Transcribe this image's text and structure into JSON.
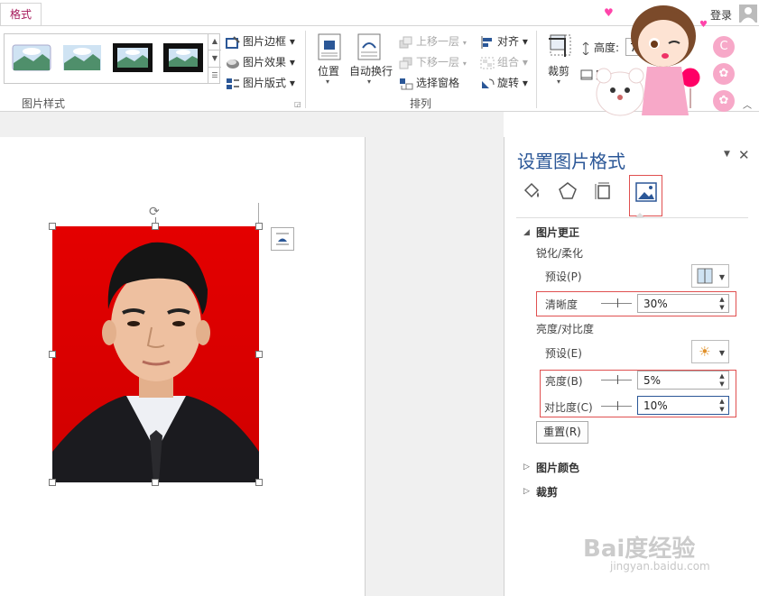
{
  "tabs": {
    "active": "格式"
  },
  "account": {
    "login": "登录"
  },
  "ribbon": {
    "picture_styles": {
      "label": "图片样式"
    },
    "style_buttons": {
      "border": "图片边框",
      "effects": "图片效果",
      "layout": "图片版式"
    },
    "arrange": {
      "label": "排列",
      "position": "位置",
      "wrap_text": "自动换行",
      "bring_forward": "上移一层",
      "send_backward": "下移一层",
      "selection_pane": "选择窗格",
      "align": "对齐",
      "group": "组合",
      "rotate": "旋转"
    },
    "size": {
      "crop": "裁剪",
      "height_label": "高度:",
      "height_value": "7",
      "width_label": "宽"
    }
  },
  "pane": {
    "title": "设置图片格式",
    "section_correction": "图片更正",
    "sharpen_soften": "锐化/柔化",
    "preset": "预设(P)",
    "clarity_label": "清晰度",
    "clarity_value": "30%",
    "brightness_contrast": "亮度/对比度",
    "preset2": "预设(E)",
    "brightness_label": "亮度(B)",
    "brightness_value": "5%",
    "contrast_label": "对比度(C)",
    "contrast_value": "10%",
    "reset": "重置(R)",
    "section_color": "图片颜色",
    "section_crop": "裁剪"
  },
  "watermark": {
    "brand": "Bai度经验",
    "url": "jingyan.baidu.com"
  },
  "colors": {
    "accent": "#2b5797",
    "tab_active": "#a5185a",
    "highlight_box": "#e05050",
    "photo_bg": "#e20000"
  }
}
